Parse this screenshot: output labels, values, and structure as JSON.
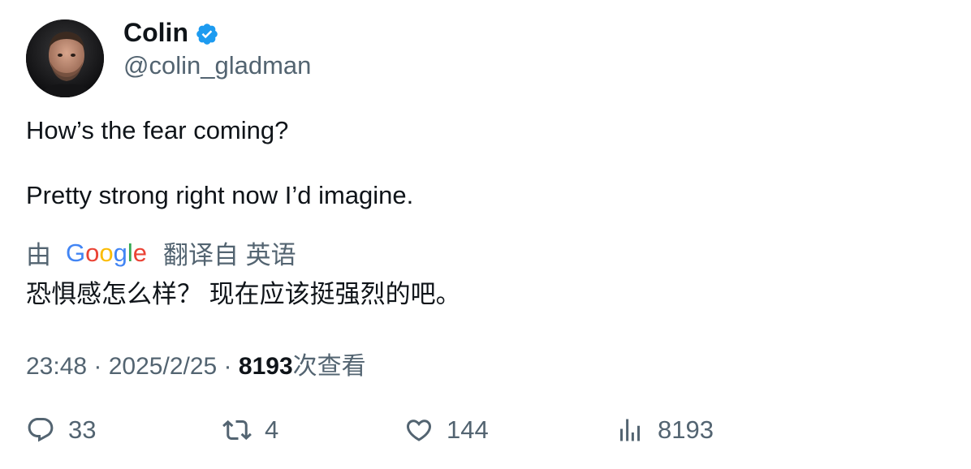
{
  "author": {
    "display_name": "Colin",
    "handle": "@colin_gladman",
    "verified_icon": "verified-badge-icon",
    "verified_color": "#1d9bf0"
  },
  "tweet": {
    "line1": "How’s the fear coming?",
    "line2": "Pretty strong right now I’d imagine."
  },
  "translation": {
    "by_label": "由",
    "provider_logo_text": "Google",
    "from_label": "翻译自 英语",
    "text": "恐惧感怎么样？ 现在应该挺强烈的吧。"
  },
  "meta": {
    "time": "23:48",
    "date": "2025/2/25",
    "views_count": "8193",
    "views_label": "次查看",
    "separator": " · "
  },
  "actions": {
    "replies": "33",
    "retweets": "4",
    "likes": "144",
    "views": "8193"
  },
  "colors": {
    "text_primary": "#0f1419",
    "text_secondary": "#536471",
    "google_blue": "#4285F4",
    "google_red": "#EA4335",
    "google_yellow": "#FBBC05",
    "google_green": "#34A853"
  }
}
